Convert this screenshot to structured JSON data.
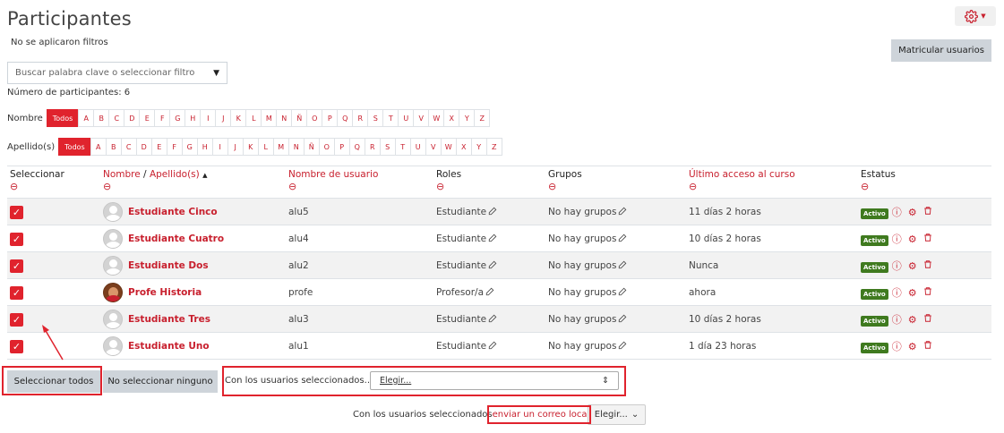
{
  "page": {
    "title": "Participantes",
    "no_filters": "No se aplicaron filtros",
    "enrol_button": "Matricular usuarios",
    "filter_placeholder": "Buscar palabra clave o seleccionar filtro",
    "participant_count": "Número de participantes: 6"
  },
  "initials": {
    "first_label": "Nombre",
    "last_label": "Apellido(s)",
    "all_label": "Todos",
    "letters": [
      "A",
      "B",
      "C",
      "D",
      "E",
      "F",
      "G",
      "H",
      "I",
      "J",
      "K",
      "L",
      "M",
      "N",
      "Ñ",
      "O",
      "P",
      "Q",
      "R",
      "S",
      "T",
      "U",
      "V",
      "W",
      "X",
      "Y",
      "Z"
    ]
  },
  "table": {
    "headers": {
      "select": "Seleccionar",
      "name": "Nombre",
      "slash": " / ",
      "lastname": "Apellido(s)",
      "sort_icon": "▲",
      "username": "Nombre de usuario",
      "roles": "Roles",
      "groups": "Grupos",
      "last_access": "Último acceso al curso",
      "status": "Estatus"
    },
    "rows": [
      {
        "name": "Estudiante Cinco",
        "username": "alu5",
        "role": "Estudiante",
        "groups": "No hay grupos",
        "last_access": "11 días 2 horas",
        "status": "Activo",
        "avatar": "default"
      },
      {
        "name": "Estudiante Cuatro",
        "username": "alu4",
        "role": "Estudiante",
        "groups": "No hay grupos",
        "last_access": "10 días 2 horas",
        "status": "Activo",
        "avatar": "default"
      },
      {
        "name": "Estudiante Dos",
        "username": "alu2",
        "role": "Estudiante",
        "groups": "No hay grupos",
        "last_access": "Nunca",
        "status": "Activo",
        "avatar": "default"
      },
      {
        "name": "Profe Historia",
        "username": "profe",
        "role": "Profesor/a",
        "groups": "No hay grupos",
        "last_access": "ahora",
        "status": "Activo",
        "avatar": "teacher"
      },
      {
        "name": "Estudiante Tres",
        "username": "alu3",
        "role": "Estudiante",
        "groups": "No hay grupos",
        "last_access": "10 días 2 horas",
        "status": "Activo",
        "avatar": "default"
      },
      {
        "name": "Estudiante Uno",
        "username": "alu1",
        "role": "Estudiante",
        "groups": "No hay grupos",
        "last_access": "1 día 23 horas",
        "status": "Activo",
        "avatar": "default"
      }
    ]
  },
  "actions": {
    "select_all": "Seleccionar todos",
    "select_none": "No seleccionar ninguno",
    "with_selected": "Con los usuarios seleccionados...",
    "choose": "Elegir...",
    "bottom_prefix": "Con los usuarios seleccionados",
    "bottom_link": "enviar un correo local...",
    "bottom_button": "Elegir..."
  },
  "colors": {
    "accent": "#e0232d",
    "link": "#c8202e",
    "status_green": "#3f7a1f"
  }
}
